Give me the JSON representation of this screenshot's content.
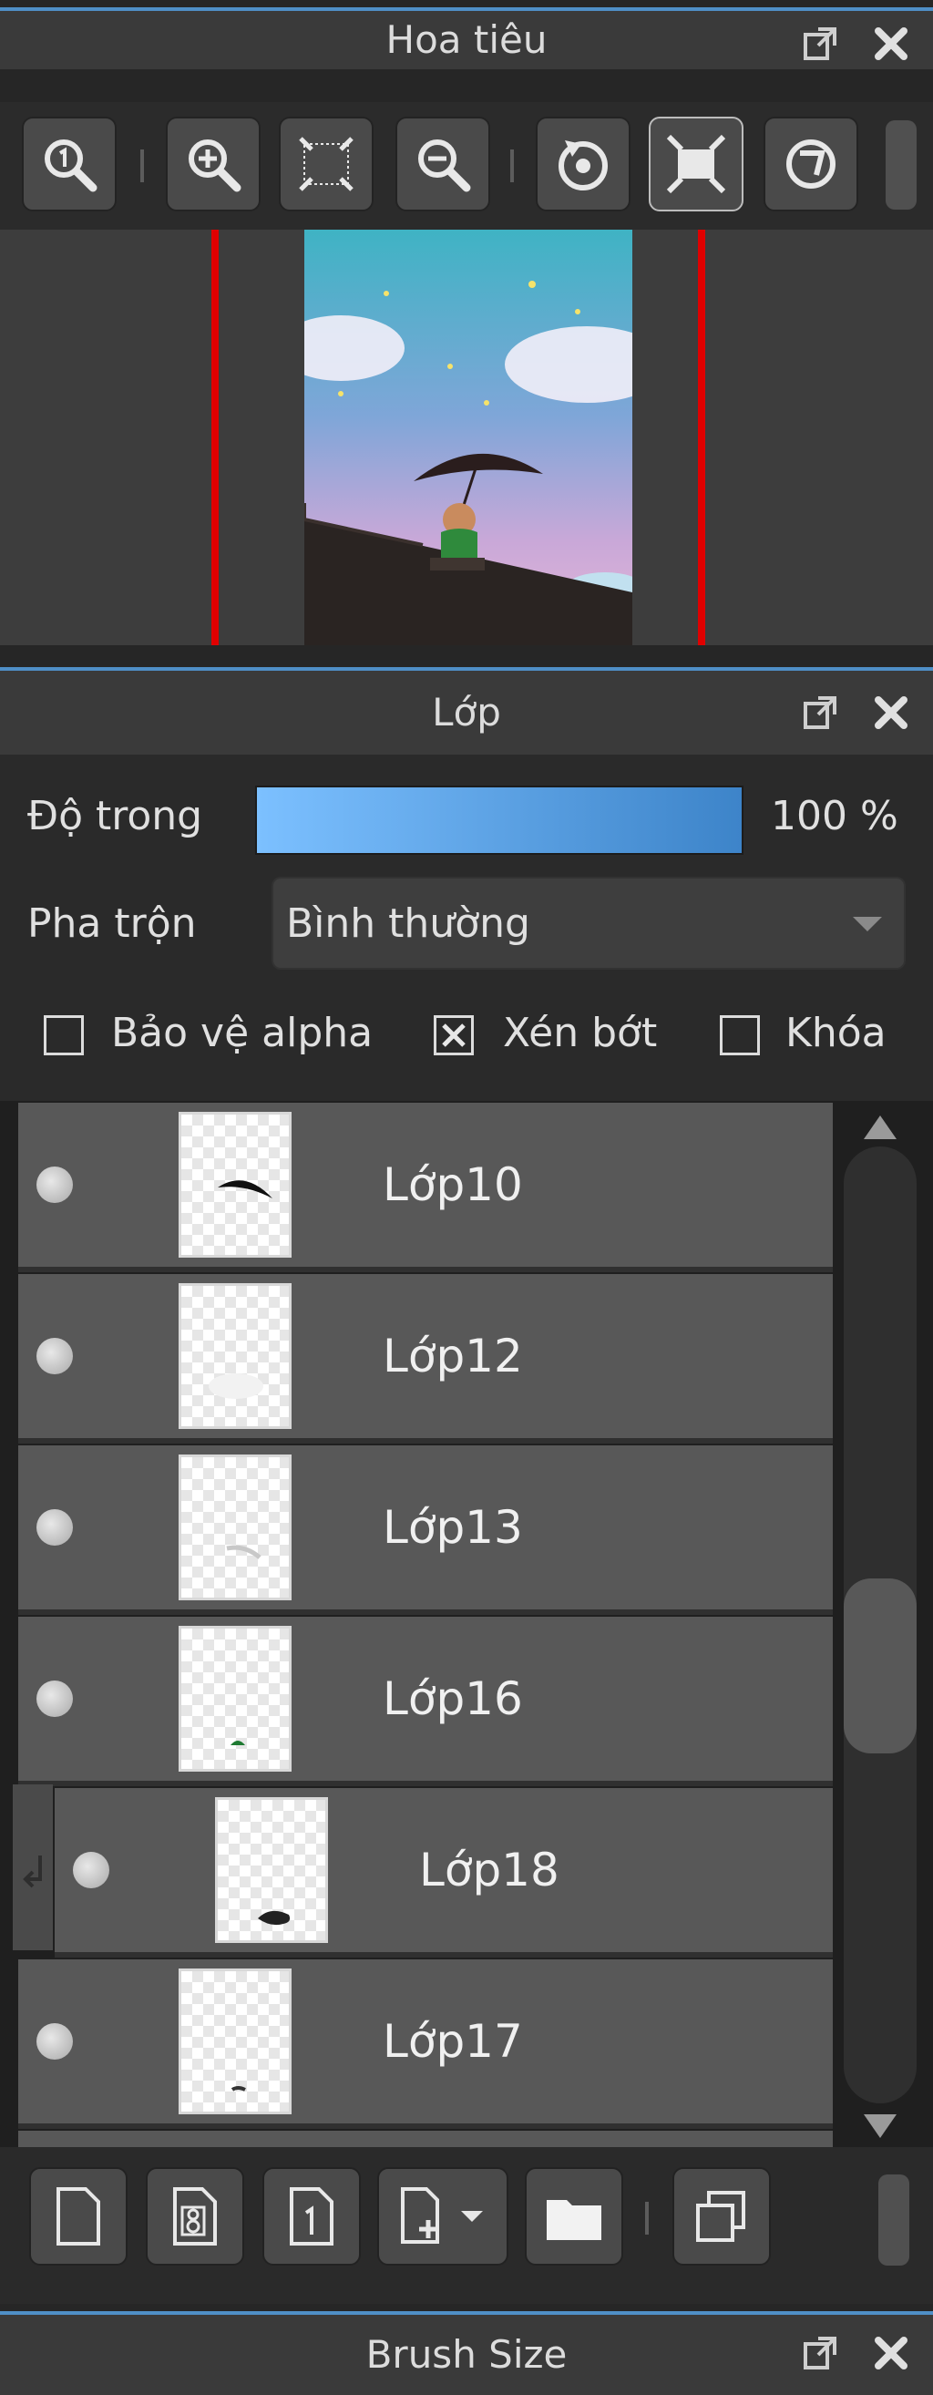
{
  "navigator": {
    "title": "Hoa tiêu",
    "toolbar": [
      "zoom-actual-icon",
      "zoom-in-icon",
      "fit-screen-icon",
      "zoom-out-icon",
      "rotate-left-icon",
      "fullscreen-icon",
      "rotate-reset-icon"
    ]
  },
  "layers": {
    "title": "Lớp",
    "opacity_label": "Độ trong",
    "opacity_value": "100 %",
    "opacity_fraction": 1.0,
    "blend_label": "Pha trộn",
    "blend_value": "Bình thường",
    "checkboxes": [
      {
        "label": "Bảo vệ alpha",
        "checked": false
      },
      {
        "label": "Xén bớt",
        "checked": true
      },
      {
        "label": "Khóa",
        "checked": false
      }
    ],
    "items": [
      {
        "name": "Lớp10",
        "visible": true,
        "child": false
      },
      {
        "name": "Lớp12",
        "visible": true,
        "child": false
      },
      {
        "name": "Lớp13",
        "visible": true,
        "child": false
      },
      {
        "name": "Lớp16",
        "visible": true,
        "child": false
      },
      {
        "name": "Lớp18",
        "visible": true,
        "child": true
      },
      {
        "name": "Lớp17",
        "visible": true,
        "child": false
      }
    ],
    "toolbar": [
      "new-layer-icon",
      "new-8bit-layer-icon",
      "new-1bit-layer-icon",
      "add-layer-menu-icon",
      "new-folder-icon",
      "duplicate-layer-icon"
    ]
  },
  "brush_size": {
    "title": "Brush Size"
  },
  "colors": {
    "accent": "#4f8fc7",
    "frame_marker": "#e00000"
  }
}
